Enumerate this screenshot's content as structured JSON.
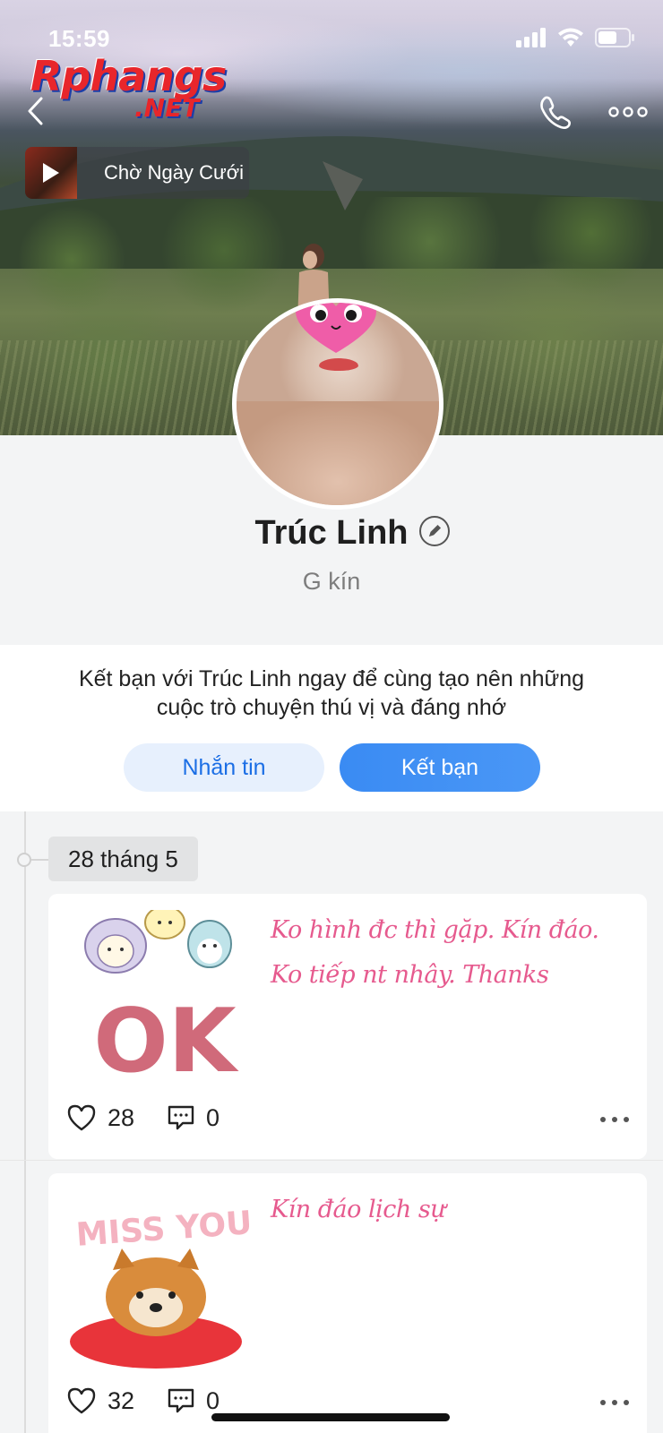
{
  "status_bar": {
    "time": "15:59"
  },
  "watermark": {
    "top": "Rphangs",
    "bottom": ".NET"
  },
  "music": {
    "title": "Chờ Ngày Cưới"
  },
  "profile": {
    "name": "Trúc Linh",
    "subtitle": "G kín"
  },
  "friend_prompt": {
    "text_line1": "Kết bạn với Trúc Linh ngay để cùng tạo nên những",
    "text_line2": "cuộc trò chuyện thú vị và đáng nhớ",
    "message_label": "Nhắn tin",
    "add_friend_label": "Kết bạn"
  },
  "timeline": {
    "date": "28 tháng 5",
    "posts": [
      {
        "text": "Ko hình đc thì gặp. Kín đáo. Ko tiếp nt nhây. Thanks",
        "sticker": "OK",
        "likes": "28",
        "comments": "0"
      },
      {
        "text": "Kín đáo lịch sự",
        "sticker": "MISS YOU",
        "likes": "32",
        "comments": "0"
      }
    ]
  },
  "colors": {
    "accent": "#3a8bf3",
    "post_text": "#e65a8e",
    "background": "#f3f4f5"
  },
  "icons": [
    "back-icon",
    "phone-icon",
    "more-icon",
    "play-icon",
    "edit-icon",
    "heart-icon",
    "comment-icon"
  ]
}
